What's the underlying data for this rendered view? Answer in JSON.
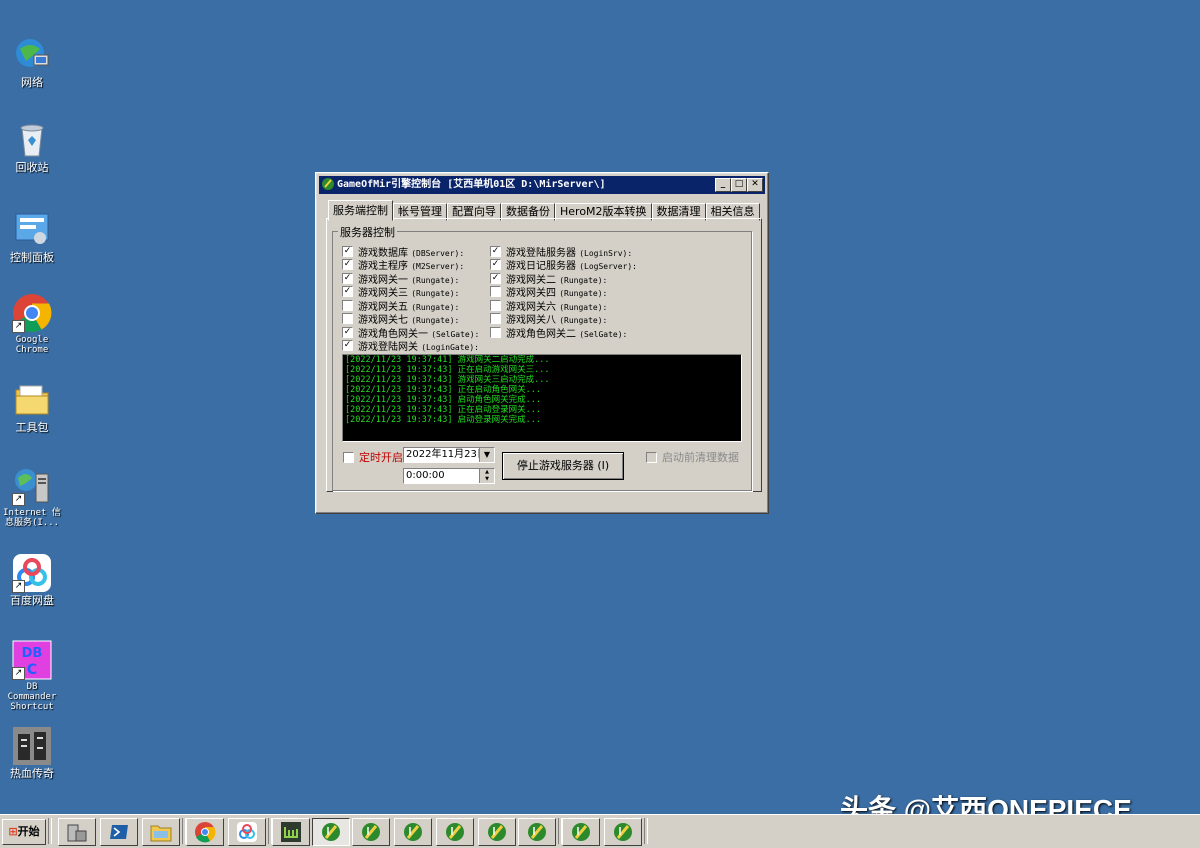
{
  "desktop": {
    "icons": [
      {
        "label": "网络"
      },
      {
        "label": "回收站"
      },
      {
        "label": "控制面板"
      },
      {
        "label": "Google Chrome"
      },
      {
        "label": "工具包"
      },
      {
        "label": "Internet 信息服务(I..."
      },
      {
        "label": "百度网盘"
      },
      {
        "label": "DB Commander Shortcut"
      },
      {
        "label": "热血传奇"
      }
    ]
  },
  "window": {
    "title": "GameOfMir引擎控制台 [艾西单机01区 D:\\MirServer\\]",
    "tabs": [
      "服务端控制",
      "帐号管理",
      "配置向导",
      "数据备份",
      "HeroM2版本转换",
      "数据清理",
      "相关信息"
    ],
    "active_tab": 0,
    "group_title": "服务器控制",
    "left_checks": [
      {
        "label": "游戏数据库",
        "en": "(DBServer):",
        "checked": true
      },
      {
        "label": "游戏主程序",
        "en": "(M2Server):",
        "checked": true
      },
      {
        "label": "游戏网关一",
        "en": "(Rungate):",
        "checked": true
      },
      {
        "label": "游戏网关三",
        "en": "(Rungate):",
        "checked": true
      },
      {
        "label": "游戏网关五",
        "en": "(Rungate):",
        "checked": false
      },
      {
        "label": "游戏网关七",
        "en": "(Rungate):",
        "checked": false
      },
      {
        "label": "游戏角色网关一",
        "en": "(SelGate):",
        "checked": true
      },
      {
        "label": "游戏登陆网关",
        "en": "(LoginGate):",
        "checked": true
      }
    ],
    "right_checks": [
      {
        "label": "游戏登陆服务器",
        "en": "(LoginSrv):",
        "checked": true
      },
      {
        "label": "游戏日记服务器",
        "en": "(LogServer):",
        "checked": true
      },
      {
        "label": "游戏网关二",
        "en": "(Rungate):",
        "checked": true
      },
      {
        "label": "游戏网关四",
        "en": "(Rungate):",
        "checked": false
      },
      {
        "label": "游戏网关六",
        "en": "(Rungate):",
        "checked": false
      },
      {
        "label": "游戏网关八",
        "en": "(Rungate):",
        "checked": false
      },
      {
        "label": "游戏角色网关二",
        "en": "(SelGate):",
        "checked": false
      }
    ],
    "log_lines": [
      "[2022/11/23 19:37:41] 游戏网关二启动完成...",
      "[2022/11/23 19:37:43] 正在启动游戏网关三...",
      "[2022/11/23 19:37:43] 游戏网关三启动完成...",
      "[2022/11/23 19:37:43] 正在启动角色网关...",
      "[2022/11/23 19:37:43] 启动角色网关完成...",
      "[2022/11/23 19:37:43] 正在启动登录网关...",
      "[2022/11/23 19:37:43] 启动登录网关完成..."
    ],
    "timer_label": "定时开启",
    "date_value": "2022年11月23日",
    "time_value": "0:00:00",
    "stop_button": "停止游戏服务器 (I)",
    "clean_label": "启动前清理数据",
    "colors": {
      "log_text": "#22dd22",
      "title_bar": "#0a246a",
      "desktop": "#3a6ea5"
    }
  },
  "taskbar": {
    "start_label": "开始"
  },
  "watermark": "头条 @艾西ONEPIECE"
}
